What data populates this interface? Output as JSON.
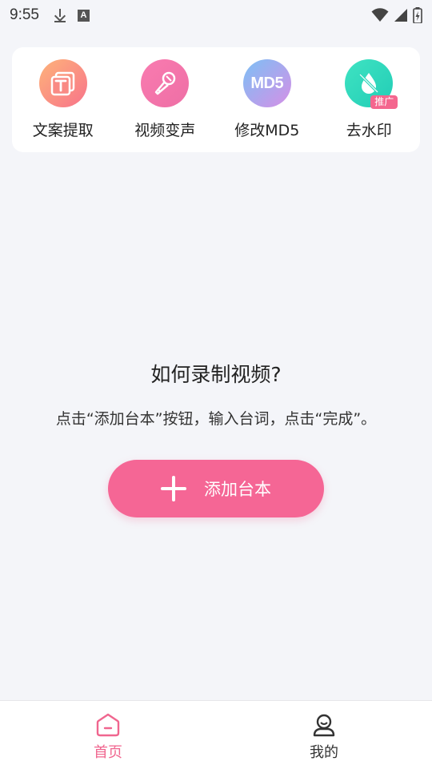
{
  "status_bar": {
    "time": "9:55",
    "left_icons": [
      "download-icon",
      "a-notification-icon"
    ],
    "right_icons": [
      "wifi-icon",
      "signal-icon",
      "battery-icon"
    ]
  },
  "tools": [
    {
      "label": "文案提取",
      "icon": "text-extract-icon"
    },
    {
      "label": "视频变声",
      "icon": "microphone-icon"
    },
    {
      "label": "修改MD5",
      "icon": "md5-icon",
      "icon_text": "MD5"
    },
    {
      "label": "去水印",
      "icon": "watermark-remove-icon",
      "badge": "推广"
    }
  ],
  "empty_state": {
    "title": "如何录制视频?",
    "description": "点击“添加台本”按钮，输入台词，点击“完成”。"
  },
  "add_button": {
    "label": "添加台本"
  },
  "tab_bar": {
    "items": [
      {
        "label": "首页",
        "active": true
      },
      {
        "label": "我的",
        "active": false
      }
    ]
  },
  "colors": {
    "accent": "#f56695",
    "background": "#f4f5f9"
  }
}
